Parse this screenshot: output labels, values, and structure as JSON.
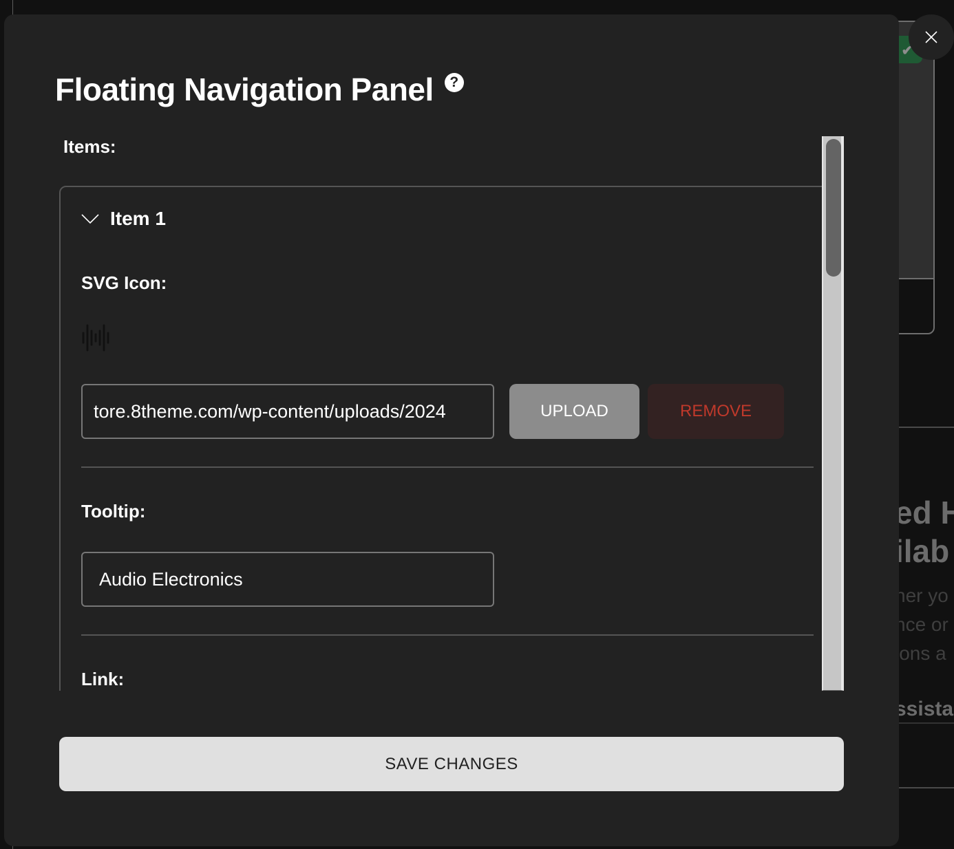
{
  "modal": {
    "title": "Floating Navigation Panel",
    "help_icon": "question-circle-icon",
    "close_icon": "close-icon",
    "items_label": "Items:",
    "items": [
      {
        "title": "Item 1",
        "expanded": true,
        "toggle_icon": "chevron-down-icon",
        "svg_icon_label": "SVG Icon:",
        "svg_icon_preview": "audio-waveform-icon",
        "svg_url_value": "tore.8theme.com/wp-content/uploads/2024",
        "upload_label": "UPLOAD",
        "remove_label": "REMOVE",
        "tooltip_label": "Tooltip:",
        "tooltip_value": "Audio Electronics",
        "link_label": "Link:"
      }
    ],
    "save_label": "SAVE CHANGES"
  },
  "background": {
    "heading_line1": "ed H",
    "heading_line2": "ilab",
    "para_line1": "her yo",
    "para_line2": "nce or",
    "para_line3": "ions a",
    "link_text": "ssista",
    "badge_icon": "check-icon",
    "badge_glyph": "✔"
  },
  "colors": {
    "modal_bg": "#222222",
    "page_bg": "#111111",
    "upload_bg": "#8c8c8c",
    "remove_bg": "#332222",
    "remove_text": "#c0392b",
    "save_bg": "#e0e0e0",
    "badge_bg": "#1f5a34"
  }
}
